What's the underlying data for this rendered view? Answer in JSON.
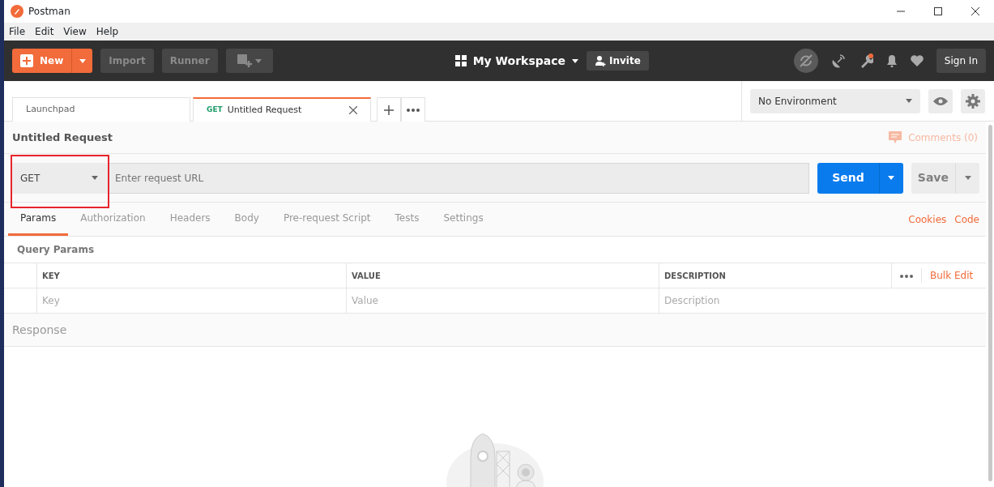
{
  "window": {
    "title": "Postman"
  },
  "menu": [
    "File",
    "Edit",
    "View",
    "Help"
  ],
  "toolbar": {
    "new_label": "New",
    "import_label": "Import",
    "runner_label": "Runner",
    "workspace": "My Workspace",
    "invite": "Invite",
    "sign_in": "Sign In",
    "notification_dot": true
  },
  "tabs": [
    {
      "label": "Launchpad",
      "selected": false
    },
    {
      "label": "Untitled Request",
      "method": "GET",
      "selected": true
    }
  ],
  "environment": {
    "value": "No Environment"
  },
  "request": {
    "name": "Untitled Request",
    "comments": "Comments (0)",
    "method": "GET",
    "method_highlighted": true,
    "url_placeholder": "Enter request URL",
    "send": "Send",
    "save": "Save"
  },
  "request_tabs": [
    {
      "label": "Params",
      "selected": true
    },
    {
      "label": "Authorization",
      "selected": false
    },
    {
      "label": "Headers",
      "selected": false
    },
    {
      "label": "Body",
      "selected": false
    },
    {
      "label": "Pre-request Script",
      "selected": false
    },
    {
      "label": "Tests",
      "selected": false
    },
    {
      "label": "Settings",
      "selected": false
    }
  ],
  "request_links": [
    "Cookies",
    "Code"
  ],
  "query_params": {
    "title": "Query Params",
    "columns": [
      "KEY",
      "VALUE",
      "DESCRIPTION"
    ],
    "bulk_edit": "Bulk Edit",
    "placeholders": [
      "Key",
      "Value",
      "Description"
    ]
  },
  "response": {
    "title": "Response"
  }
}
